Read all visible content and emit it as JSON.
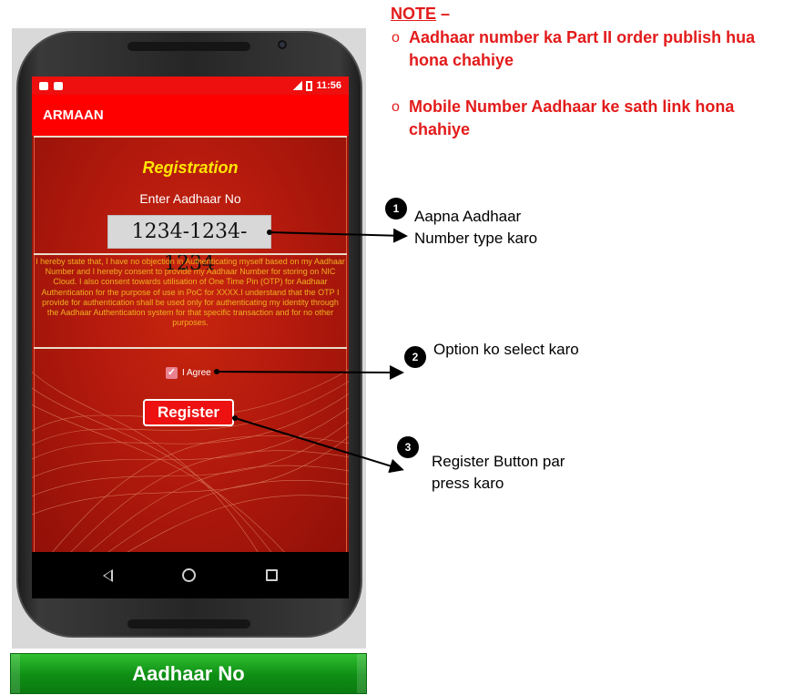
{
  "status_bar": {
    "time": "11:56"
  },
  "app": {
    "title": "ARMAAN",
    "registration_title": "Registration",
    "aadhaar_label": "Enter Aadhaar No",
    "aadhaar_value": "1234-1234-1234",
    "consent_text": "I hereby state that, I have no objection in Authenticating myself based on my Aadhaar Number and I hereby consent to provide my Aadhaar Number for storing on NIC Cloud. I also consent towards utilisation of One Time Pin (OTP) for Aadhaar Authentication for the purpose of use in PoC for XXXX.I understand that the OTP I provide for authentication shall be used only for authenticating my identity through the Aadhaar Authentication system for that specific transaction and for no other purposes.",
    "agree_label": "I Agree",
    "agree_checked": true,
    "register_label": "Register"
  },
  "note": {
    "title": "NOTE",
    "dash": " –",
    "items": [
      "Aadhaar number ka Part II order publish hua hona chahiye",
      "Mobile Number Aadhaar ke sath link hona chahiye"
    ]
  },
  "steps": [
    {
      "number": "1",
      "text": "Aapna Aadhaar Number type karo"
    },
    {
      "number": "2",
      "text": "Option ko select karo"
    },
    {
      "number": "3",
      "text": "Register Button par press karo"
    }
  ],
  "banner": {
    "label": "Aadhaar No"
  },
  "colors": {
    "app_red": "#ff0000",
    "note_red": "#e31b1b",
    "title_yellow": "#ffe600",
    "consent_orange": "#f0b020",
    "banner_green": "#0e8e14"
  },
  "icons": [
    "back-icon",
    "home-icon",
    "recent-apps-icon",
    "signal-icon",
    "battery-icon"
  ]
}
